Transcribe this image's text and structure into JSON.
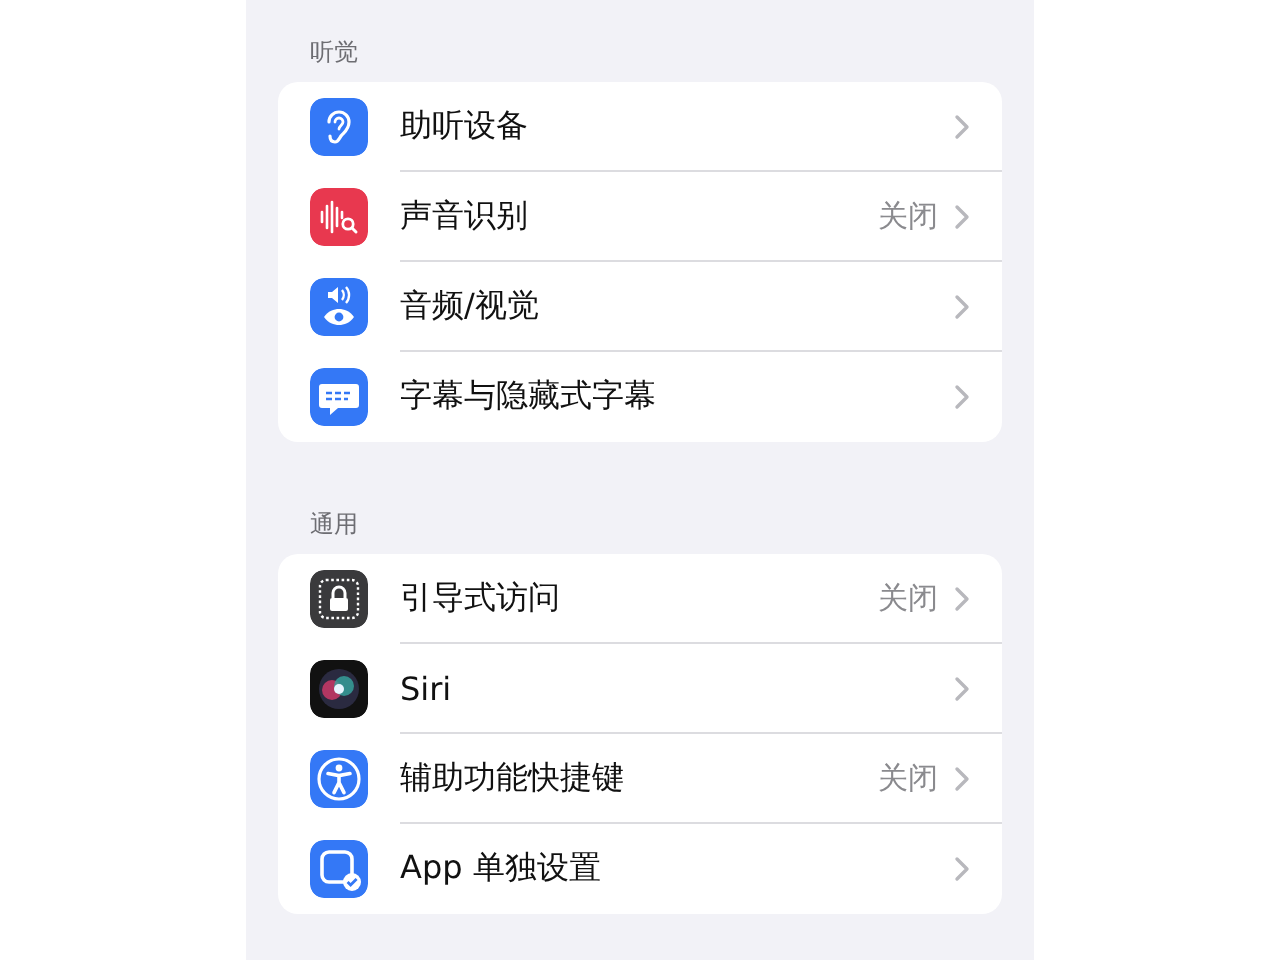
{
  "sections": [
    {
      "header": "听觉",
      "rows": [
        {
          "kind": "ear",
          "label": "助听设备"
        },
        {
          "kind": "sound",
          "label": "声音识别",
          "value": "关闭"
        },
        {
          "kind": "audio",
          "label": "音频/视觉"
        },
        {
          "kind": "subtitles",
          "label": "字幕与隐藏式字幕"
        }
      ]
    },
    {
      "header": "通用",
      "rows": [
        {
          "kind": "lock",
          "label": "引导式访问",
          "value": "关闭"
        },
        {
          "kind": "siri",
          "label": "Siri"
        },
        {
          "kind": "accessibility",
          "label": "辅助功能快捷键",
          "value": "关闭"
        },
        {
          "kind": "app",
          "label": "App 单独设置"
        }
      ]
    }
  ]
}
